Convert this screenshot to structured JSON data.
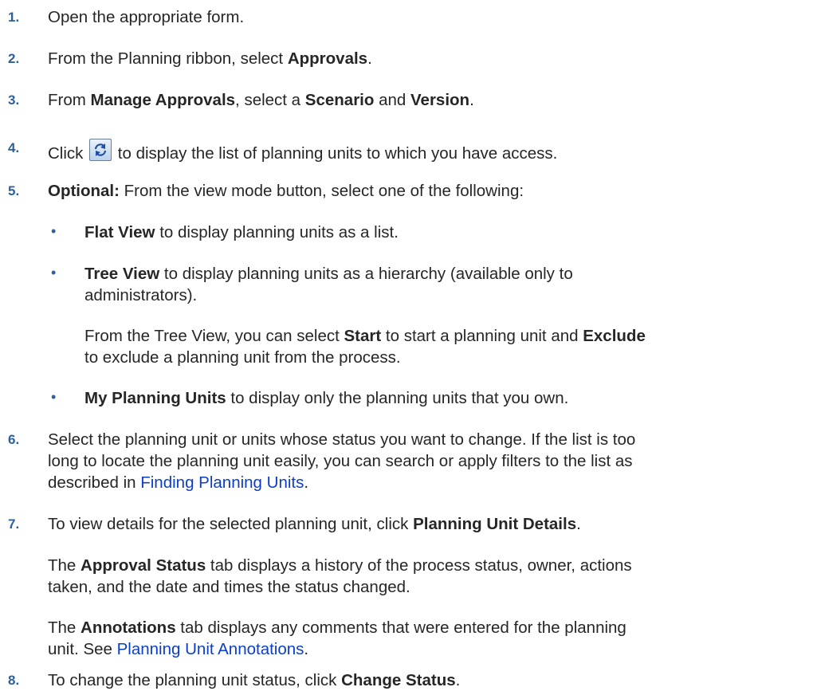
{
  "steps": [
    {
      "num": "1.",
      "text": "Open the appropriate form."
    },
    {
      "num": "2.",
      "pre": "From the Planning ribbon, select ",
      "b1": "Approvals",
      "post": "."
    },
    {
      "num": "3.",
      "pre": "From ",
      "b1": "Manage Approvals",
      "mid1": ", select a ",
      "b2": "Scenario",
      "mid2": " and ",
      "b3": "Version",
      "post": "."
    },
    {
      "num": "4.",
      "pre": "Click ",
      "post": " to display the list of planning units to which you have access.",
      "icon": "refresh-icon"
    },
    {
      "num": "5.",
      "b1": "Optional:",
      "post": " From the view mode button, select one of the following:"
    },
    {
      "num": "6.",
      "line1": "Select the planning unit or units whose status you want to change. If the list is too",
      "line2": "long to locate the planning unit easily, you can search or apply filters to the list as",
      "line3_pre": "described in ",
      "link": "Finding Planning Units",
      "line3_post": "."
    },
    {
      "num": "7.",
      "pre": "To view details for the selected planning unit, click ",
      "b1": "Planning Unit Details",
      "post": "."
    },
    {
      "num": "8.",
      "pre": "To change the planning unit status, click ",
      "b1": "Change Status",
      "post": "."
    }
  ],
  "view_options": [
    {
      "b": "Flat View",
      "text": " to display planning units as a list."
    },
    {
      "b": "Tree View",
      "text": " to display planning units as a hierarchy (available only to",
      "text2": "administrators)."
    },
    {
      "b": "My Planning Units",
      "text": " to display only the planning units that you own."
    }
  ],
  "tree_note": {
    "pre": "From the Tree View, you can select ",
    "b1": "Start",
    "mid": " to start a planning unit and ",
    "b2": "Exclude",
    "line2": "to exclude a planning unit from the process."
  },
  "approval_status_note": {
    "pre": "The ",
    "b": "Approval Status",
    "post": " tab displays a history of the process status, owner, actions",
    "line2": "taken, and the date and times the status changed."
  },
  "annotations_note": {
    "pre": "The ",
    "b": "Annotations",
    "post": " tab displays any comments that were entered for the planning",
    "line2_pre": "unit. See ",
    "link": "Planning Unit Annotations",
    "line2_post": "."
  },
  "colors": {
    "number": "#2e5f98",
    "link": "#0b3ec9",
    "text": "#262626"
  }
}
